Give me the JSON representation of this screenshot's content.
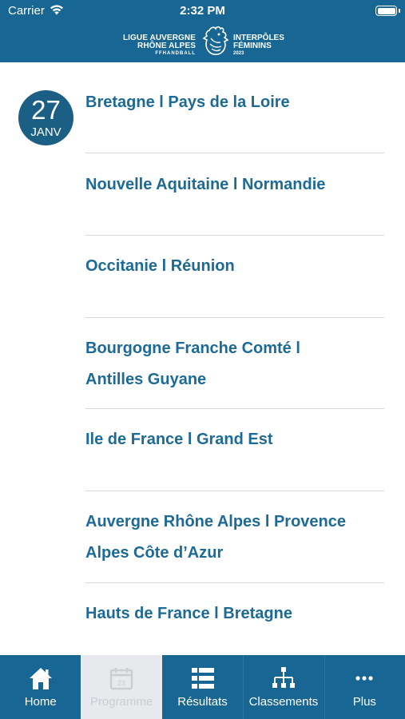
{
  "status_bar": {
    "carrier": "Carrier",
    "time": "2:32 PM"
  },
  "brand": {
    "left_line1": "LIGUE AUVERGNE",
    "left_line2": "RHÔNE ALPES",
    "left_sub": "FFHANDBALL",
    "right_line1": "INTERPÔLES",
    "right_line2": "FÉMININS",
    "right_sub": "2023"
  },
  "date": {
    "day": "27",
    "month": "JANV"
  },
  "matches": [
    {
      "line1": "Bretagne l Pays de la Loire",
      "line2": ""
    },
    {
      "line1": "Nouvelle Aquitaine l Normandie",
      "line2": ""
    },
    {
      "line1": "Occitanie l Réunion",
      "line2": ""
    },
    {
      "line1": "Bourgogne Franche Comté l",
      "line2": "Antilles Guyane"
    },
    {
      "line1": "Ile de France l Grand Est",
      "line2": ""
    },
    {
      "line1": "Auvergne Rhône Alpes l Provence",
      "line2": "Alpes Côte d’Azur"
    },
    {
      "line1": "Hauts de France l Bretagne",
      "line2": ""
    }
  ],
  "tabs": [
    {
      "label": "Home",
      "icon": "home-icon",
      "active": false
    },
    {
      "label": "Programme",
      "icon": "calendar-icon",
      "active": true
    },
    {
      "label": "Résultats",
      "icon": "list-icon",
      "active": false
    },
    {
      "label": "Classements",
      "icon": "hierarchy-icon",
      "active": false
    },
    {
      "label": "Plus",
      "icon": "more-dots-icon",
      "active": false
    }
  ],
  "colors": {
    "primary": "#186693",
    "match_text": "#1d6a97",
    "date_badge": "#1b5f85",
    "active_tab_bg": "#e7e9ec",
    "divider": "#d9d9d9"
  }
}
